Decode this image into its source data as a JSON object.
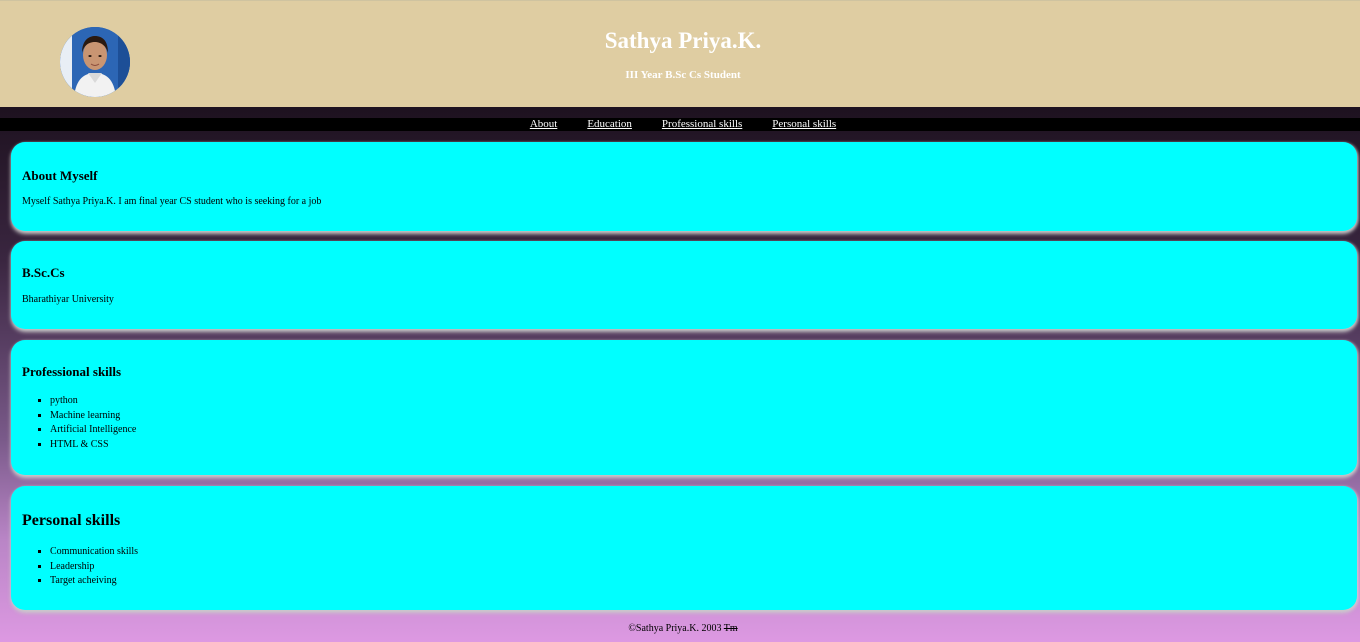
{
  "header": {
    "name": "Sathya Priya.K.",
    "subtitle": "III Year B.Sc Cs Student"
  },
  "nav": {
    "items": [
      "About",
      "Education",
      "Professional skills",
      "Personal skills"
    ]
  },
  "about": {
    "heading": "About Myself",
    "text": "Myself Sathya Priya.K. I am final year CS student who is seeking for a job"
  },
  "education": {
    "heading": "B.Sc.Cs",
    "text": "Bharathiyar University"
  },
  "professional": {
    "heading": "Professional skills",
    "items": [
      "python",
      "Machine learning",
      "Artificial Intelligence",
      "HTML & CSS"
    ]
  },
  "personal": {
    "heading": "Personal skills",
    "items": [
      "Communication skills",
      "Leadership",
      "Target acheiving"
    ]
  },
  "footer": {
    "text": "©Sathya Priya.K. 2003",
    "mark": "Tm"
  },
  "colors": {
    "header_bg": "#dfcda2",
    "card_bg": "#00ffff",
    "navbar_bg": "#000000"
  }
}
